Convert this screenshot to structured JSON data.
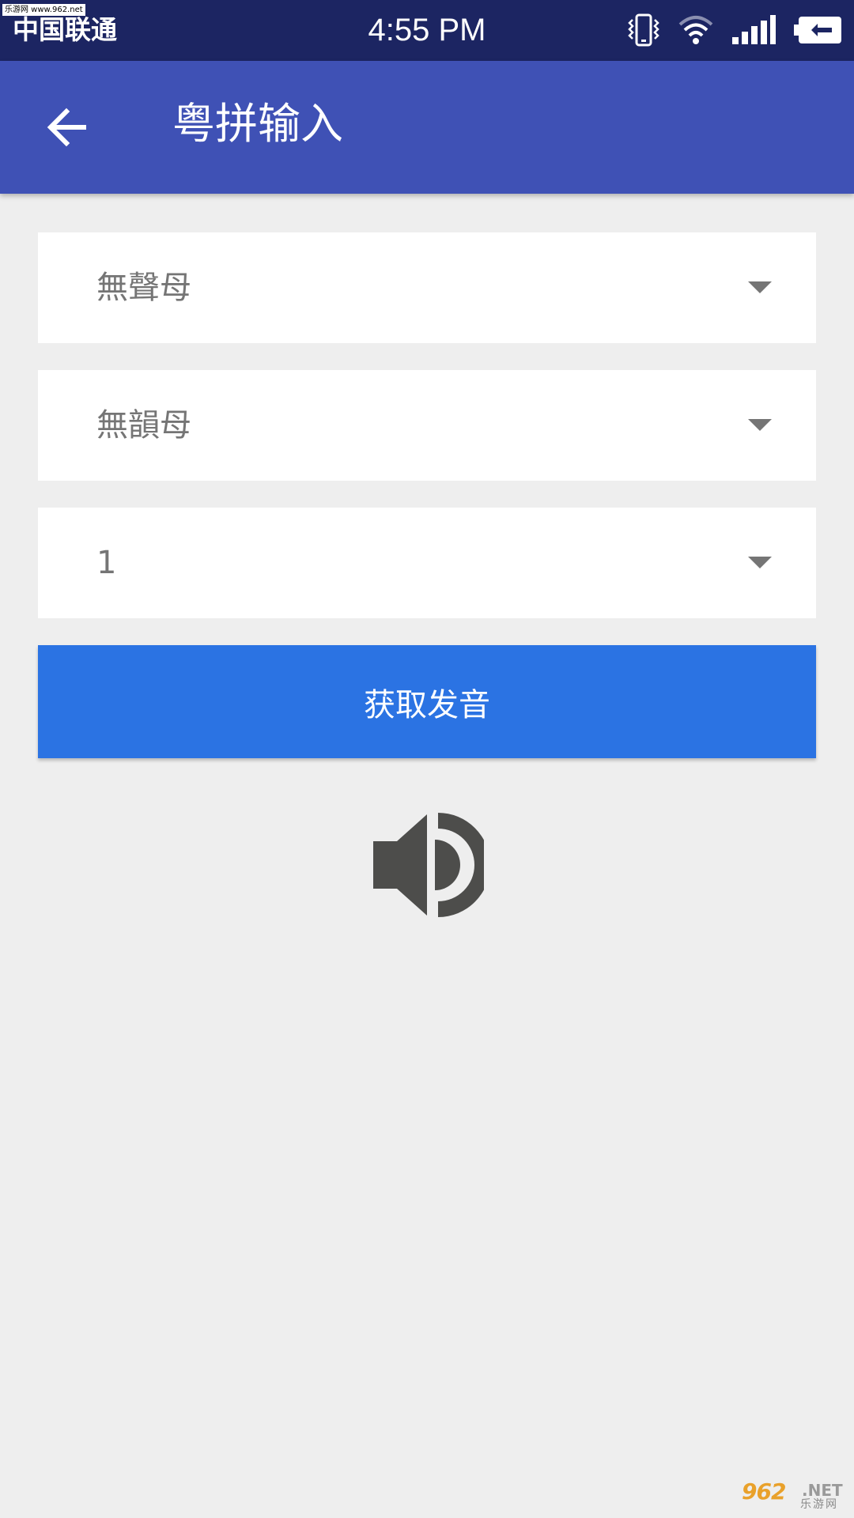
{
  "status_bar": {
    "watermark": "乐游网 www.962.net",
    "carrier": "中国联通",
    "time": "4:55 PM",
    "icons": [
      "vibrate-icon",
      "wifi-icon",
      "signal-icon",
      "battery-charging-icon"
    ]
  },
  "app_bar": {
    "back_icon": "arrow-back-icon",
    "title": "粤拼输入",
    "color": "#3f51b5"
  },
  "form": {
    "initial_spinner": {
      "selected": "無聲母"
    },
    "final_spinner": {
      "selected": "無韻母"
    },
    "tone_spinner": {
      "selected": "1"
    },
    "get_pronunciation_button": {
      "label": "获取发音",
      "color": "#2b73e3"
    },
    "play_icon": "speaker-volume-icon"
  },
  "watermark": {
    "main": "962",
    "net": ".NET",
    "sub": "乐游网"
  }
}
